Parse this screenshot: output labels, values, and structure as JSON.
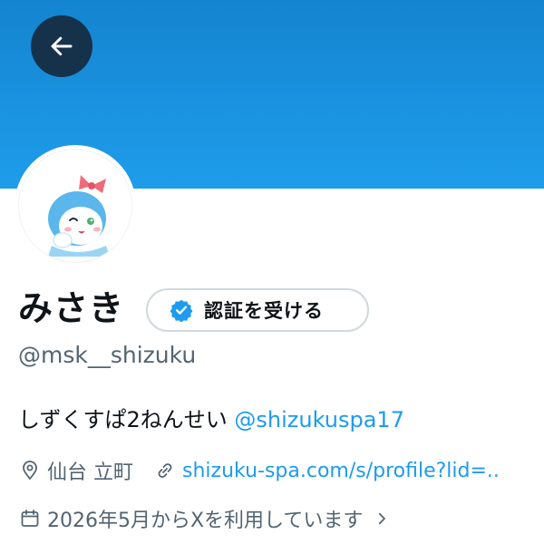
{
  "profile": {
    "name": "みさき",
    "handle": "@msk__shizuku",
    "verify_label": "認証を受ける",
    "bio_text": "しずくすぱ2ねんせい ",
    "bio_mention": "@shizukuspa17",
    "location": "仙台 立町",
    "website": "shizuku-spa.com/s/profile?lid=..",
    "joined": "2026年5月からXを利用しています"
  },
  "icons": {
    "back": "arrow-left-icon",
    "verified": "verified-badge-icon",
    "location": "location-pin-icon",
    "link": "link-icon",
    "calendar": "calendar-icon",
    "chevron": "chevron-right-icon"
  },
  "colors": {
    "banner": "#1a92df",
    "accent": "#1d9bf0",
    "text_primary": "#0f1419",
    "text_secondary": "#536471",
    "back_button_bg": "#16324a"
  }
}
